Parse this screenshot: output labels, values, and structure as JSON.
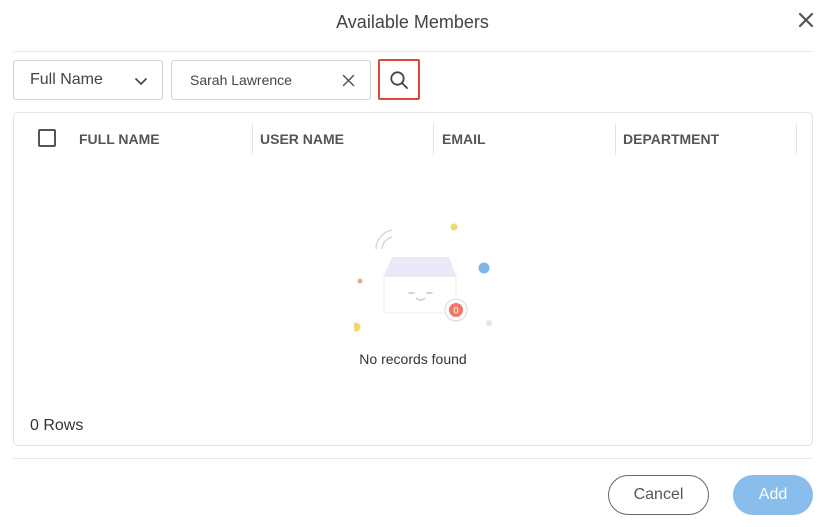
{
  "dialog": {
    "title": "Available Members"
  },
  "filter": {
    "field_selected": "Full Name",
    "search_value": "Sarah Lawrence",
    "search_placeholder": ""
  },
  "grid": {
    "columns": [
      "FULL NAME",
      "USER NAME",
      "EMAIL",
      "DEPARTMENT"
    ],
    "rows": [],
    "empty_text": "No records found",
    "empty_badge": "0",
    "row_count": "0 Rows"
  },
  "footer": {
    "cancel_label": "Cancel",
    "add_label": "Add"
  },
  "colors": {
    "accent": "#89bdeb",
    "highlight": "#e0463c",
    "badge": "#f07a6a"
  },
  "icons": [
    "close-icon",
    "chevron-down-icon",
    "clear-icon",
    "search-icon",
    "empty-box-icon"
  ]
}
